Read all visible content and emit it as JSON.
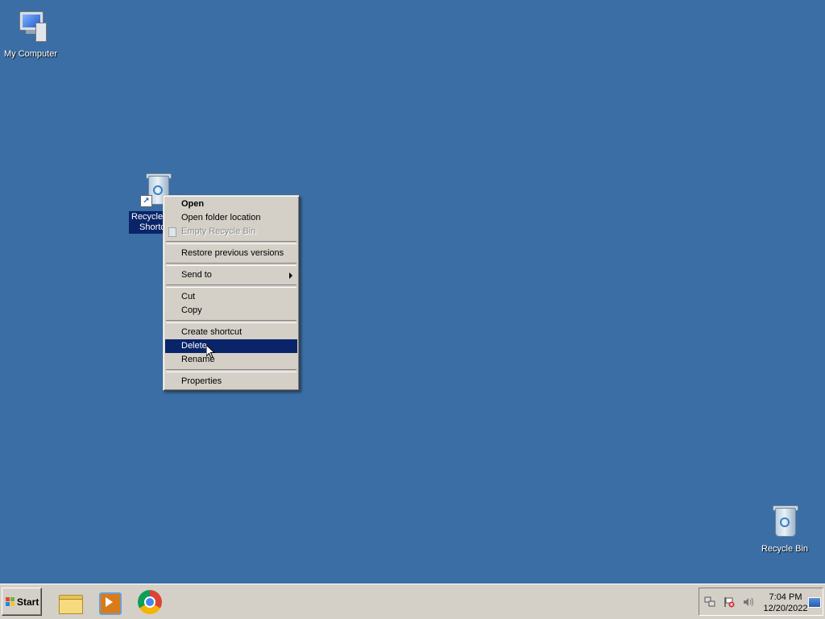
{
  "desktop": {
    "background_color": "#3a6ea5",
    "icons": [
      {
        "label": "My Computer",
        "icon": "my-computer-icon"
      },
      {
        "label_line1": "Recycle",
        "label_line2": "Shortc",
        "icon": "recycle-bin-shortcut-icon",
        "selected": true
      },
      {
        "label": "Recycle Bin",
        "icon": "recycle-bin-icon"
      }
    ]
  },
  "context_menu": {
    "items": [
      {
        "label": "Open",
        "bold": true
      },
      {
        "label": "Open folder location"
      },
      {
        "label": "Empty Recycle Bin",
        "disabled": true
      },
      {
        "label": "Restore previous versions"
      },
      {
        "label": "Send to",
        "submenu": true
      },
      {
        "label": "Cut"
      },
      {
        "label": "Copy"
      },
      {
        "label": "Create shortcut"
      },
      {
        "label": "Delete",
        "highlighted": true
      },
      {
        "label": "Rename"
      },
      {
        "label": "Properties"
      }
    ],
    "highlight_color": "#0a246a"
  },
  "taskbar": {
    "start_label": "Start",
    "quick_launch": [
      "folder-icon",
      "media-player-icon",
      "chrome-icon"
    ],
    "tray": {
      "icons": [
        "network-icon",
        "action-center-icon",
        "volume-icon"
      ],
      "time": "7:04 PM",
      "date": "12/20/2022"
    }
  }
}
